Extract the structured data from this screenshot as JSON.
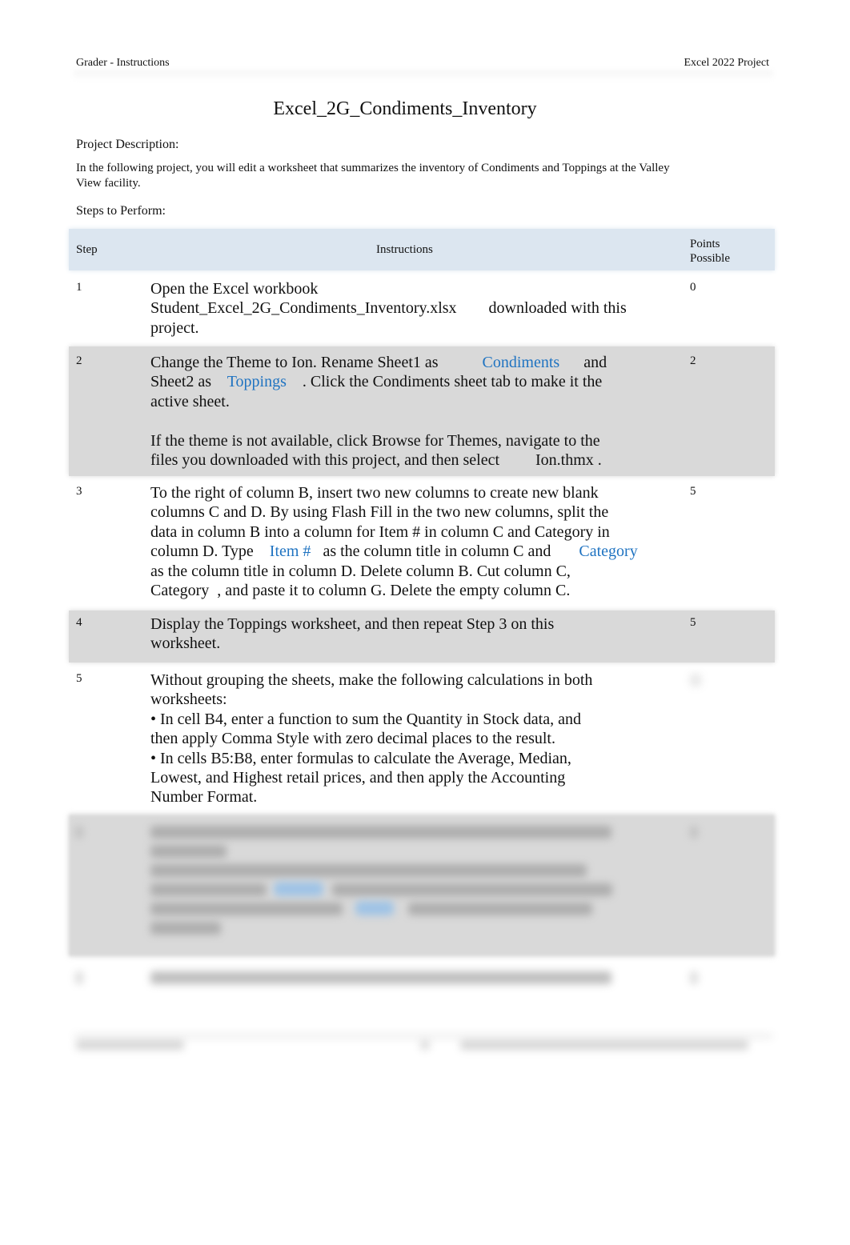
{
  "header": {
    "left": "Grader - Instructions",
    "right": "Excel 2022 Project"
  },
  "title": "Excel_2G_Condiments_Inventory",
  "description_label": "Project Description:",
  "description_lines": [
    "In the following project, you will edit a worksheet that summarizes the inventory of Condiments and Toppings at the Valley",
    "View facility."
  ],
  "steps_label": "Steps to Perform:",
  "table": {
    "columns": {
      "step": "Step",
      "instructions": "Instructions",
      "points_line1": "Points",
      "points_line2": "Possible"
    },
    "colors": {
      "header_bg": "#dce6f0",
      "shaded_row_bg": "#d9d9d9",
      "link": "#1f73c1"
    },
    "rows": [
      {
        "step": "1",
        "points": "0",
        "lines": [
          [
            {
              "t": "Open the Excel workbook"
            }
          ],
          [
            {
              "t": "Student_Excel_2G_Condiments_Inventory.xlsx        downloaded with this"
            }
          ],
          [
            {
              "t": "project."
            }
          ]
        ]
      },
      {
        "step": "2",
        "points": "2",
        "lines": [
          [
            {
              "t": "Change the Theme to Ion. Rename Sheet1 as           "
            },
            {
              "t": "Condiments",
              "link": true
            },
            {
              "t": "      and"
            }
          ],
          [
            {
              "t": "Sheet2 as    "
            },
            {
              "t": "Toppings",
              "link": true
            },
            {
              "t": "    . Click the Condiments sheet tab to make it the"
            }
          ],
          [
            {
              "t": "active sheet."
            }
          ],
          [
            {
              "t": ""
            }
          ],
          [
            {
              "t": "If the theme is not available, click Browse for Themes, navigate to the"
            }
          ],
          [
            {
              "t": "files you downloaded with this project, and then select         Ion.thmx ."
            }
          ]
        ]
      },
      {
        "step": "3",
        "points": "5",
        "lines": [
          [
            {
              "t": "To the right of column B, insert two new columns to create new blank"
            }
          ],
          [
            {
              "t": "columns C and D. By using Flash Fill in the two new columns, split the"
            }
          ],
          [
            {
              "t": "data in column B into a column for Item # in column C and Category in"
            }
          ],
          [
            {
              "t": "column D. Type    "
            },
            {
              "t": "Item #",
              "link": true
            },
            {
              "t": "   as the column title in column C and       "
            },
            {
              "t": "Category",
              "link": true
            }
          ],
          [
            {
              "t": "as the column title in column D. Delete column B. Cut column C,"
            }
          ],
          [
            {
              "t": "Category  , and paste it to column G. Delete the empty column C."
            }
          ]
        ]
      },
      {
        "step": "4",
        "points": "5",
        "lines": [
          [
            {
              "t": "Display the Toppings worksheet, and then repeat Step 3 on this"
            }
          ],
          [
            {
              "t": "worksheet."
            }
          ]
        ]
      },
      {
        "step": "5",
        "points": "",
        "lines": [
          [
            {
              "t": "Without grouping the sheets, make the following calculations in both"
            }
          ],
          [
            {
              "t": "worksheets:"
            }
          ],
          [
            {
              "t": "• In cell B4, enter a function to sum the Quantity in Stock data, and"
            }
          ],
          [
            {
              "t": "then apply Comma Style with zero decimal places to the result."
            }
          ],
          [
            {
              "t": "• In cells B5:B8, enter formulas to calculate the Average, Median,"
            }
          ],
          [
            {
              "t": "Lowest, and Highest retail prices, and then apply the Accounting"
            }
          ],
          [
            {
              "t": "Number Format."
            }
          ]
        ]
      }
    ]
  }
}
